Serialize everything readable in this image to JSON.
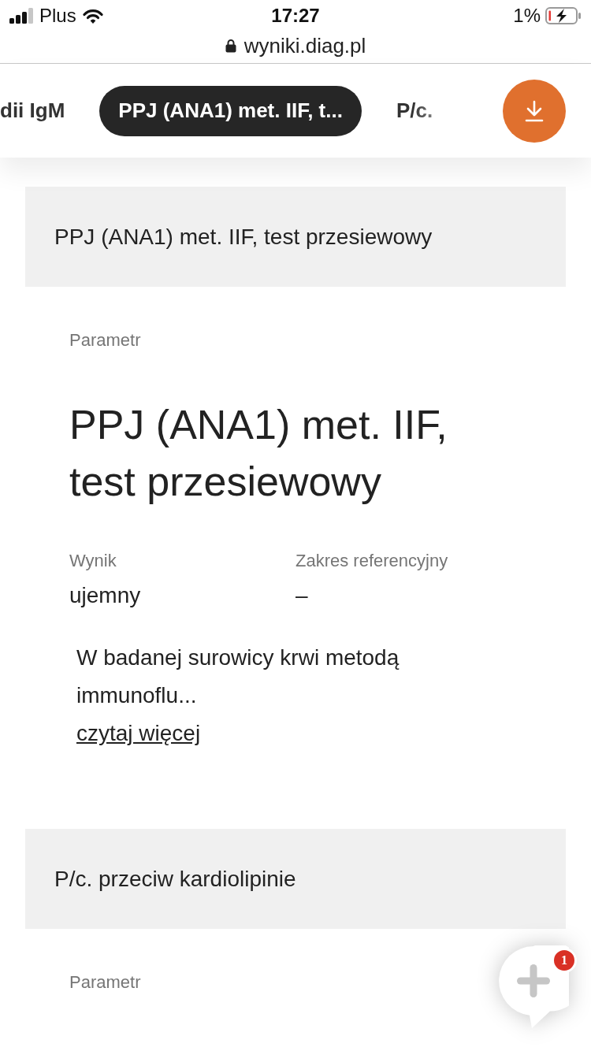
{
  "status_bar": {
    "carrier": "Plus",
    "time": "17:27",
    "battery": "1%"
  },
  "address_bar": {
    "url": "wyniki.diag.pl"
  },
  "tabs": [
    {
      "label": "dii IgM",
      "selected": false
    },
    {
      "label": "PPJ (ANA1) met. IIF, t...",
      "selected": true
    },
    {
      "label": "P/c.",
      "selected": false
    }
  ],
  "sections": [
    {
      "header": "PPJ (ANA1) met. IIF, test przesiewowy",
      "parameter_label": "Parametr",
      "parameter": "PPJ (ANA1) met. IIF, test przesiewowy",
      "result_label": "Wynik",
      "result": "ujemny",
      "range_label": "Zakres referencyjny",
      "range": "–",
      "description": "W badanej surowicy krwi metodą immunoflu...",
      "read_more": "czytaj więcej"
    },
    {
      "header": "P/c. przeciw kardiolipinie",
      "parameter_label": "Parametr"
    }
  ],
  "chat_button": {
    "badge": "1"
  }
}
